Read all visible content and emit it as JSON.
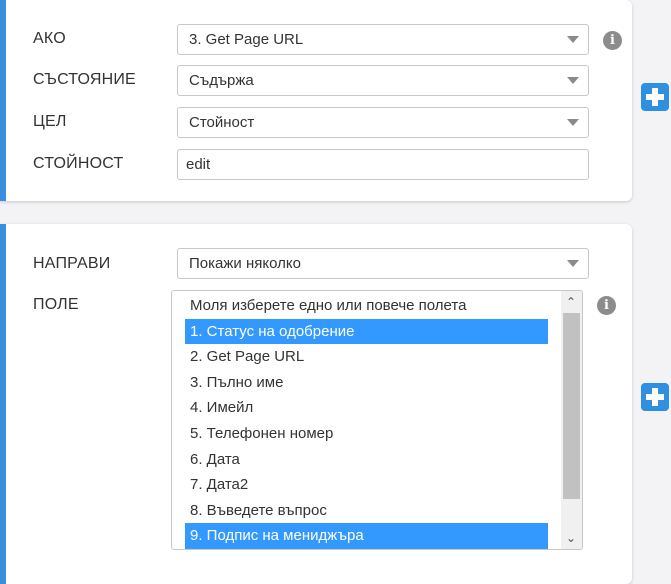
{
  "condition": {
    "if_label": "АКО",
    "if_value": "3. Get Page URL",
    "state_label": "СЪСТОЯНИЕ",
    "state_value": "Съдържа",
    "target_label": "ЦЕЛ",
    "target_value": "Стойност",
    "value_label": "СТОЙНОСТ",
    "value_input": "edit"
  },
  "action": {
    "do_label": "НАПРАВИ",
    "do_value": "Покажи няколко",
    "field_label": "ПОЛЕ",
    "field_options": [
      {
        "label": "Моля изберете едно или повече полета",
        "selected": false
      },
      {
        "label": "1. Статус на одобрение",
        "selected": true
      },
      {
        "label": "2. Get Page URL",
        "selected": false
      },
      {
        "label": "3. Пълно име",
        "selected": false
      },
      {
        "label": "4. Имейл",
        "selected": false
      },
      {
        "label": "5. Телефонен номер",
        "selected": false
      },
      {
        "label": "6. Дата",
        "selected": false
      },
      {
        "label": "7. Дата2",
        "selected": false
      },
      {
        "label": "8. Въведете въпрос",
        "selected": false
      },
      {
        "label": "9. Подпис на мениджъра",
        "selected": true
      }
    ]
  },
  "icons": {
    "info": "info-icon",
    "add": "plus-icon",
    "dropdown": "chevron-down-icon"
  },
  "colors": {
    "accent": "#3b8fde",
    "selected": "#3399ff",
    "add_button": "#2f8fe0"
  }
}
